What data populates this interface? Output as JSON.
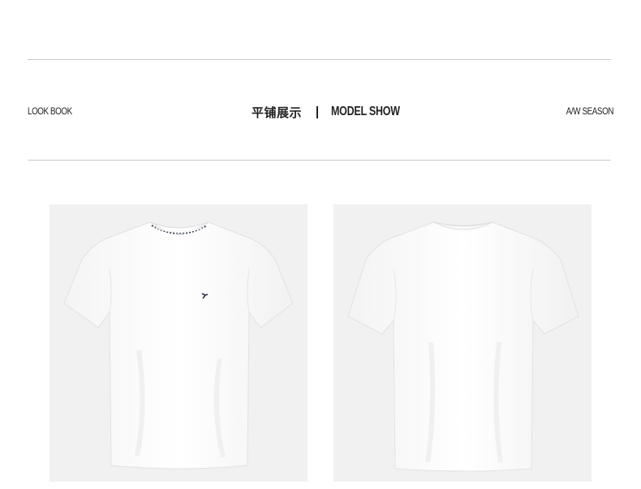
{
  "header": {
    "left_label": "LOOK BOOK",
    "cn_title": "平铺展示",
    "en_title": "MODEL SHOW",
    "right_label": "A/W SEASON"
  },
  "products": [
    {
      "view": "front",
      "color": "#ffffff"
    },
    {
      "view": "back",
      "color": "#ffffff"
    }
  ]
}
